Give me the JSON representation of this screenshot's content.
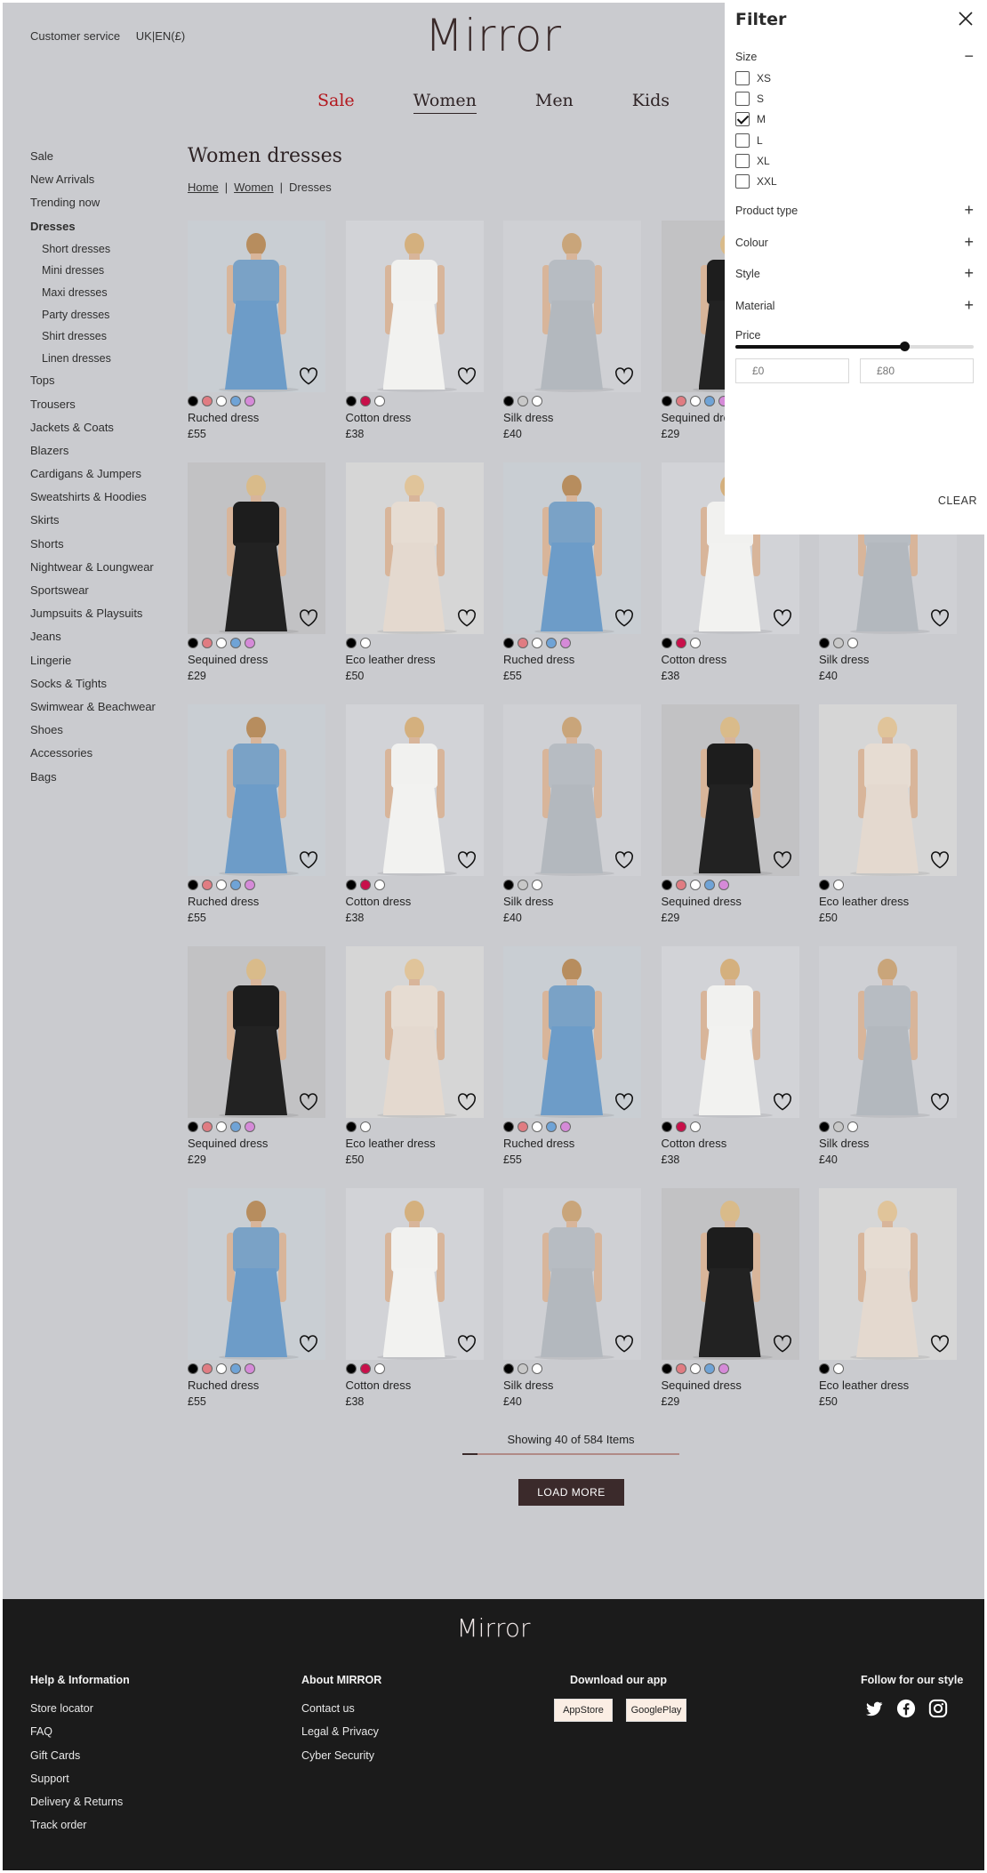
{
  "topbar": {
    "customer_service": "Customer service",
    "locale": "UK|EN(£)"
  },
  "brand": {
    "logo": "Mirror"
  },
  "mainnav": [
    {
      "label": "Sale",
      "name": "nav-sale"
    },
    {
      "label": "Women",
      "name": "nav-women"
    },
    {
      "label": "Men",
      "name": "nav-men"
    },
    {
      "label": "Kids",
      "name": "nav-kids"
    }
  ],
  "sidebar": {
    "items": [
      "Sale",
      "New Arrivals",
      "Trending now",
      "Dresses",
      "Short dresses",
      "Mini dresses",
      "Maxi dresses",
      "Party dresses",
      "Shirt dresses",
      "Linen dresses",
      "Tops",
      "Trousers",
      "Jackets & Coats",
      "Blazers",
      "Cardigans & Jumpers",
      "Sweatshirts & Hoodies",
      "Skirts",
      "Shorts",
      "Nightwear & Loungwear",
      "Sportswear",
      "Jumpsuits & Playsuits",
      "Jeans",
      "Lingerie",
      "Socks & Tights",
      "Swimwear & Beachwear",
      "Shoes",
      "Accessories",
      "Bags"
    ]
  },
  "page": {
    "title": "Women dresses"
  },
  "breadcrumb": {
    "home": "Home",
    "women": "Women",
    "current": "Dresses",
    "sep": "|"
  },
  "products": {
    "Ruched dress": {
      "price": "£55",
      "swatches": [
        "#000000",
        "#e07c82",
        "#ffffff",
        "#6fa3d6",
        "#d58ad8"
      ],
      "look": "blue"
    },
    "Cotton dress": {
      "price": "£38",
      "swatches": [
        "#000000",
        "#c8104a",
        "#ffffff"
      ],
      "look": "white"
    },
    "Silk dress": {
      "price": "£40",
      "swatches": [
        "#000000",
        "#c8c8c8",
        "#ffffff"
      ],
      "look": "silver"
    },
    "Sequined dress": {
      "price": "£29",
      "swatches": [
        "#000000",
        "#e07c82",
        "#ffffff",
        "#6fa3d6",
        "#d58ad8"
      ],
      "look": "black"
    },
    "Eco leather dress": {
      "price": "£50",
      "swatches": [
        "#000000",
        "#ffffff"
      ],
      "look": "beige"
    }
  },
  "grid": [
    [
      "Ruched dress",
      "Cotton dress",
      "Silk dress",
      "Sequined dress",
      "Eco leather dress"
    ],
    [
      "Sequined dress",
      "Eco leather dress",
      "Ruched dress",
      "Cotton dress",
      "Silk dress"
    ],
    [
      "Ruched dress",
      "Cotton dress",
      "Silk dress",
      "Sequined dress",
      "Eco leather dress"
    ],
    [
      "Sequined dress",
      "Eco leather dress",
      "Ruched dress",
      "Cotton dress",
      "Silk dress"
    ],
    [
      "Ruched dress",
      "Cotton dress",
      "Silk dress",
      "Sequined dress",
      "Eco leather dress"
    ]
  ],
  "listing": {
    "showing": "Showing 40 of 584 Items",
    "progress": 0.07,
    "load_more": "LOAD MORE"
  },
  "filter": {
    "title": "Filter",
    "size_label": "Size",
    "sizes": [
      {
        "label": "XS",
        "checked": false
      },
      {
        "label": "S",
        "checked": false
      },
      {
        "label": "M",
        "checked": true
      },
      {
        "label": "L",
        "checked": false
      },
      {
        "label": "XL",
        "checked": false
      },
      {
        "label": "XXL",
        "checked": false
      }
    ],
    "sections": [
      "Product type",
      "Colour",
      "Style",
      "Material"
    ],
    "price_label": "Price",
    "price_slider_value": 0.71,
    "min_placeholder": "£0",
    "max_placeholder": "£80",
    "clear": "CLEAR"
  },
  "footer": {
    "logo": "Mirror",
    "help": {
      "title": "Help & Information",
      "links": [
        "Store locator",
        "FAQ",
        "Gift Cards",
        "Support",
        "Delivery & Returns",
        "Track order"
      ]
    },
    "about": {
      "title": "About MIRROR",
      "links": [
        "Contact us",
        "Legal & Privacy",
        "Cyber Security"
      ]
    },
    "download": {
      "title": "Download our app",
      "appstore": "AppStore",
      "googleplay": "GooglePlay"
    },
    "follow": {
      "title": "Follow for our style",
      "icons": [
        "twitter-icon",
        "facebook-icon",
        "instagram-icon"
      ]
    }
  },
  "colors": {
    "accent": "#b3171d",
    "brand": "#3b2a2b",
    "footer_bg": "#1b1b1b",
    "page_bg": "#cacbcf"
  }
}
